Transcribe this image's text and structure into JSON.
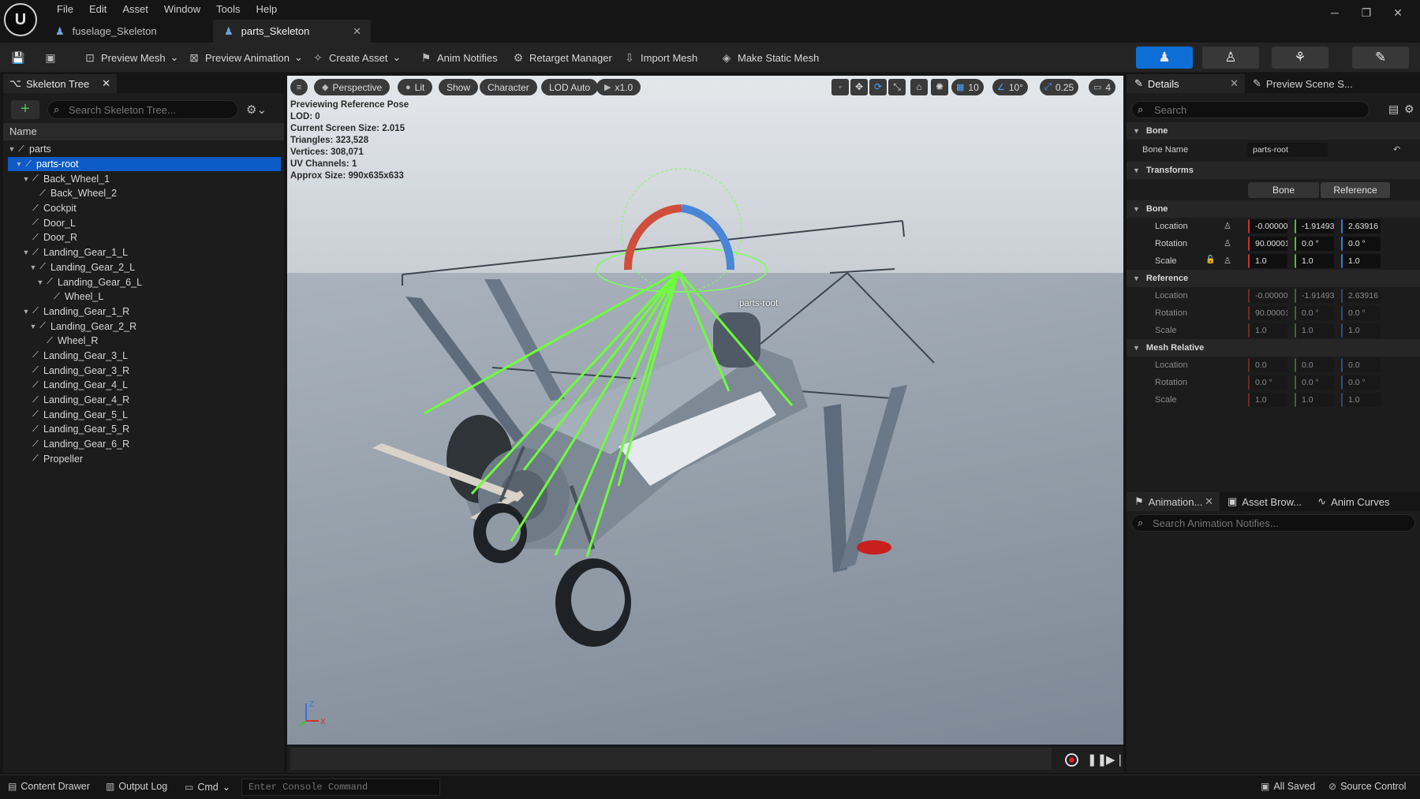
{
  "app": {
    "menu": [
      "File",
      "Edit",
      "Asset",
      "Window",
      "Tools",
      "Help"
    ],
    "tabs": [
      {
        "label": "fuselage_Skeleton",
        "active": false
      },
      {
        "label": "parts_Skeleton",
        "active": true
      }
    ],
    "window_controls": [
      "minimize-icon",
      "restore-icon",
      "close-icon"
    ]
  },
  "toolbar": {
    "save_icon": "save-icon",
    "browse_icon": "browse-icon",
    "items": [
      {
        "label": "Preview Mesh",
        "icon": "mesh-icon",
        "dropdown": true
      },
      {
        "label": "Preview Animation",
        "icon": "animation-icon",
        "dropdown": true
      },
      {
        "label": "Create Asset",
        "icon": "create-asset-icon",
        "dropdown": true
      },
      {
        "label": "Anim Notifies",
        "icon": "notify-icon",
        "dropdown": false
      },
      {
        "label": "Retarget Manager",
        "icon": "retarget-icon",
        "dropdown": false
      },
      {
        "label": "Import Mesh",
        "icon": "import-icon",
        "dropdown": false
      },
      {
        "label": "Make Static Mesh",
        "icon": "static-mesh-icon",
        "dropdown": false
      }
    ],
    "modes": [
      "skeleton-mode-icon",
      "mesh-mode-icon",
      "animation-mode-icon",
      "physics-mode-icon"
    ],
    "accent": "#0d6fd6"
  },
  "skeleton_tree": {
    "tab_label": "Skeleton Tree",
    "search_placeholder": "Search Skeleton Tree...",
    "column_header": "Name",
    "bones": [
      {
        "name": "parts",
        "depth": 0,
        "expanded": true,
        "selected": false
      },
      {
        "name": "parts-root",
        "depth": 1,
        "expanded": true,
        "selected": true
      },
      {
        "name": "Back_Wheel_1",
        "depth": 2,
        "expanded": true,
        "selected": false
      },
      {
        "name": "Back_Wheel_2",
        "depth": 3,
        "expanded": false,
        "selected": false
      },
      {
        "name": "Cockpit",
        "depth": 2,
        "expanded": false,
        "selected": false
      },
      {
        "name": "Door_L",
        "depth": 2,
        "expanded": false,
        "selected": false
      },
      {
        "name": "Door_R",
        "depth": 2,
        "expanded": false,
        "selected": false
      },
      {
        "name": "Landing_Gear_1_L",
        "depth": 2,
        "expanded": true,
        "selected": false
      },
      {
        "name": "Landing_Gear_2_L",
        "depth": 3,
        "expanded": true,
        "selected": false
      },
      {
        "name": "Landing_Gear_6_L",
        "depth": 4,
        "expanded": true,
        "selected": false
      },
      {
        "name": "Wheel_L",
        "depth": 5,
        "expanded": false,
        "selected": false
      },
      {
        "name": "Landing_Gear_1_R",
        "depth": 2,
        "expanded": true,
        "selected": false
      },
      {
        "name": "Landing_Gear_2_R",
        "depth": 3,
        "expanded": true,
        "selected": false
      },
      {
        "name": "Wheel_R",
        "depth": 4,
        "expanded": false,
        "selected": false
      },
      {
        "name": "Landing_Gear_3_L",
        "depth": 2,
        "expanded": false,
        "selected": false
      },
      {
        "name": "Landing_Gear_3_R",
        "depth": 2,
        "expanded": false,
        "selected": false
      },
      {
        "name": "Landing_Gear_4_L",
        "depth": 2,
        "expanded": false,
        "selected": false
      },
      {
        "name": "Landing_Gear_4_R",
        "depth": 2,
        "expanded": false,
        "selected": false
      },
      {
        "name": "Landing_Gear_5_L",
        "depth": 2,
        "expanded": false,
        "selected": false
      },
      {
        "name": "Landing_Gear_5_R",
        "depth": 2,
        "expanded": false,
        "selected": false
      },
      {
        "name": "Landing_Gear_6_R",
        "depth": 2,
        "expanded": false,
        "selected": false
      },
      {
        "name": "Propeller",
        "depth": 2,
        "expanded": false,
        "selected": false
      }
    ]
  },
  "viewport": {
    "view_mode": "Perspective",
    "lighting": "Lit",
    "show": "Show",
    "character": "Character",
    "lod": "LOD Auto",
    "play_speed": "x1.0",
    "grid_snap": "10",
    "rotation_snap": "10°",
    "scale_snap": "0.25",
    "camera_speed": "4",
    "stats": [
      "Previewing Reference Pose",
      "LOD: 0",
      "Current Screen Size: 2.015",
      "Triangles: 323,528",
      "Vertices: 308,071",
      "UV Channels: 1",
      "Approx Size: 990x635x633"
    ],
    "selected_bone_label": "parts-root",
    "axis_labels": [
      "Z",
      "X"
    ]
  },
  "details": {
    "tab_label": "Details",
    "second_tab_label": "Preview Scene S...",
    "search_placeholder": "Search",
    "bone_section": "Bone",
    "bone_name_label": "Bone Name",
    "bone_name_value": "parts-root",
    "transforms_section": "Transforms",
    "transform_modes": [
      "Bone",
      "Reference"
    ],
    "bone_group": {
      "title": "Bone",
      "location_label": "Location",
      "location": [
        "-0.00000",
        "-1.91493",
        "2.63916"
      ],
      "rotation_label": "Rotation",
      "rotation": [
        "90.00001",
        "0.0 °",
        "0.0 °"
      ],
      "scale_label": "Scale",
      "scale": [
        "1.0",
        "1.0",
        "1.0"
      ]
    },
    "reference_group": {
      "title": "Reference",
      "location_label": "Location",
      "location": [
        "-0.00000",
        "-1.91493",
        "2.63916"
      ],
      "rotation_label": "Rotation",
      "rotation": [
        "90.00001",
        "0.0 °",
        "0.0 °"
      ],
      "scale_label": "Scale",
      "scale": [
        "1.0",
        "1.0",
        "1.0"
      ]
    },
    "mesh_relative_group": {
      "title": "Mesh Relative",
      "location_label": "Location",
      "location": [
        "0.0",
        "0.0",
        "0.0"
      ],
      "rotation_label": "Rotation",
      "rotation": [
        "0.0 °",
        "0.0 °",
        "0.0 °"
      ],
      "scale_label": "Scale",
      "scale": [
        "1.0",
        "1.0",
        "1.0"
      ]
    }
  },
  "notifies": {
    "tabs": [
      "Animation...",
      "Asset Brow...",
      "Anim Curves"
    ],
    "search_placeholder": "Search Animation Notifies..."
  },
  "statusbar": {
    "content_drawer": "Content Drawer",
    "output_log": "Output Log",
    "cmd": "Cmd",
    "console_placeholder": "Enter Console Command",
    "all_saved": "All Saved",
    "source_control": "Source Control"
  }
}
